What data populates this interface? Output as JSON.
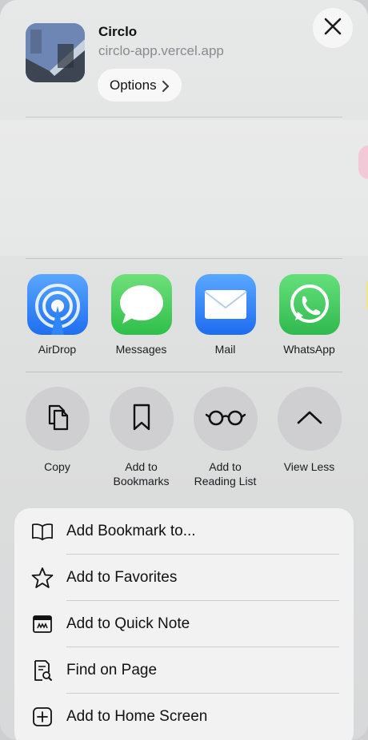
{
  "header": {
    "site_title": "Circlo",
    "site_url": "circlo-app.vercel.app",
    "options_label": "Options",
    "options_icon": "chevron-right-icon",
    "close_icon": "close-icon"
  },
  "apps": [
    {
      "label": "AirDrop",
      "icon": "airdrop-icon",
      "color": "#2f86f6"
    },
    {
      "label": "Messages",
      "icon": "messages-icon",
      "color": "#34c759"
    },
    {
      "label": "Mail",
      "icon": "mail-icon",
      "color": "#2f86f6"
    },
    {
      "label": "WhatsApp",
      "icon": "whatsapp-icon",
      "color": "#3ac05a"
    }
  ],
  "actions": [
    {
      "label": "Copy",
      "icon": "copy-icon"
    },
    {
      "label": "Add to\nBookmarks",
      "icon": "bookmark-icon"
    },
    {
      "label": "Add to\nReading List",
      "icon": "glasses-icon"
    },
    {
      "label": "View Less",
      "icon": "chevron-up-icon"
    }
  ],
  "list": [
    {
      "label": "Add Bookmark to...",
      "icon": "book-icon"
    },
    {
      "label": "Add to Favorites",
      "icon": "star-icon"
    },
    {
      "label": "Add to Quick Note",
      "icon": "quick-note-icon"
    },
    {
      "label": "Find on Page",
      "icon": "find-on-page-icon"
    },
    {
      "label": "Add to Home Screen",
      "icon": "add-square-icon"
    }
  ]
}
